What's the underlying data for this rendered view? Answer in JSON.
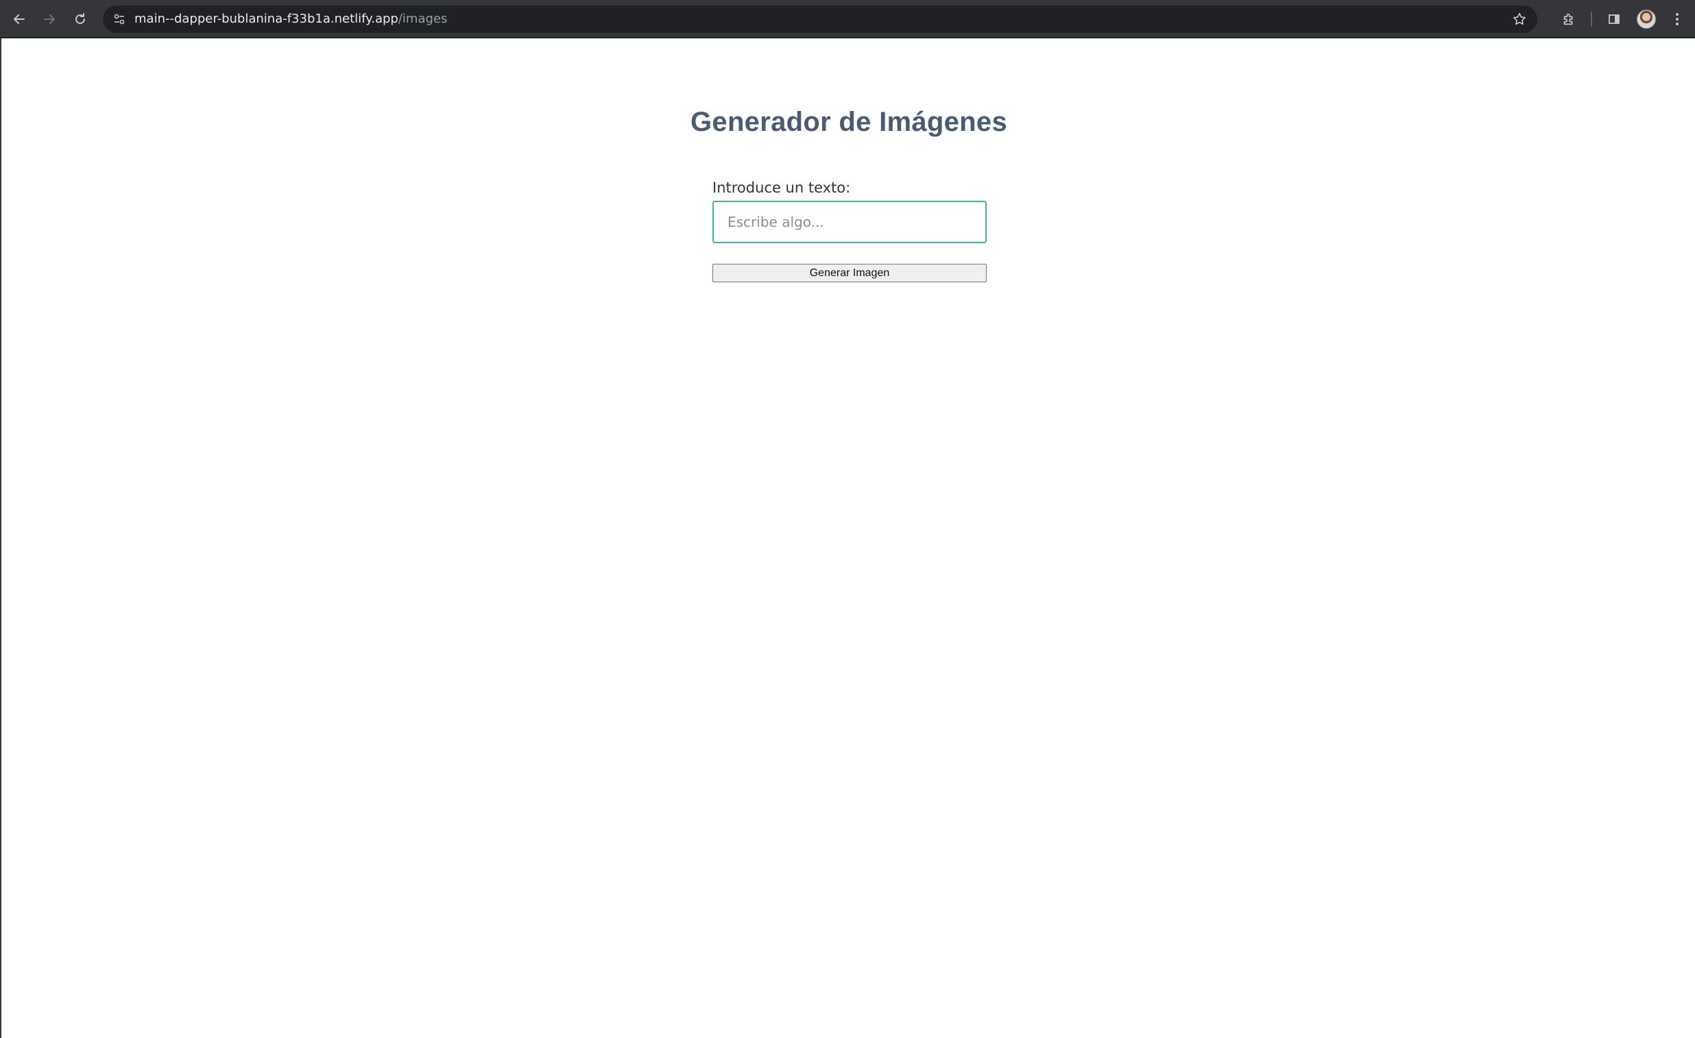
{
  "browser": {
    "url_host": "main--dapper-bublanina-f33b1a.netlify.app",
    "url_path": "/images",
    "icons": {
      "back": "back-arrow-icon",
      "forward": "forward-arrow-icon",
      "reload": "reload-icon",
      "site_info": "site-info-icon",
      "bookmark": "star-icon",
      "extensions": "puzzle-icon",
      "side_panel": "side-panel-icon",
      "profile": "avatar",
      "menu": "kebab-menu-icon"
    },
    "colors": {
      "toolbar": "#35363a",
      "omnibox": "#202124"
    }
  },
  "page": {
    "title": "Generador de Imágenes",
    "form": {
      "label": "Introduce un texto:",
      "input_placeholder": "Escribe algo...",
      "input_value": "",
      "button_label": "Generar Imagen"
    },
    "colors": {
      "title": "#4b5a73",
      "input_border": "#46b39a"
    }
  }
}
